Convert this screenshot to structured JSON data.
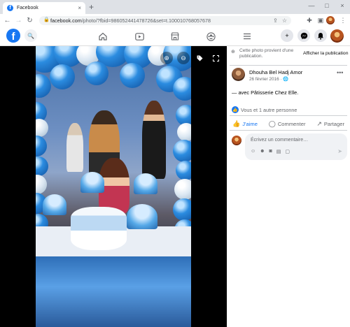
{
  "browser": {
    "tab_title": "Facebook",
    "tab_close": "×",
    "new_tab": "+",
    "url_host": "facebook.com",
    "url_path": "/photo/?fbid=986052441478726&set=t.100010768057678",
    "window_controls": [
      "—",
      "□",
      "×"
    ]
  },
  "fbnav": {
    "logo": "f"
  },
  "photo_viewer": {
    "icons": [
      "zoom-in-icon",
      "zoom-out-icon",
      "tag-icon",
      "fullscreen-icon"
    ]
  },
  "panel": {
    "notice_text": "Cette photo provient d'une publication.",
    "notice_button": "Afficher la publication",
    "author_name": "Dhouha Bel Hadj Amor",
    "post_date": "26 février 2016 ·",
    "with_prefix": "— avec ",
    "with_page": "Pâtisserie Chez Elle",
    "with_suffix": ".",
    "reactions_text": "Vous et 1 autre personne",
    "actions": {
      "like": "J'aime",
      "comment": "Commenter",
      "share": "Partager"
    },
    "comment_placeholder": "Écrivez un commentaire…"
  },
  "colors": {
    "facebook_blue": "#1877f2",
    "secondary_text": "#65676b"
  }
}
